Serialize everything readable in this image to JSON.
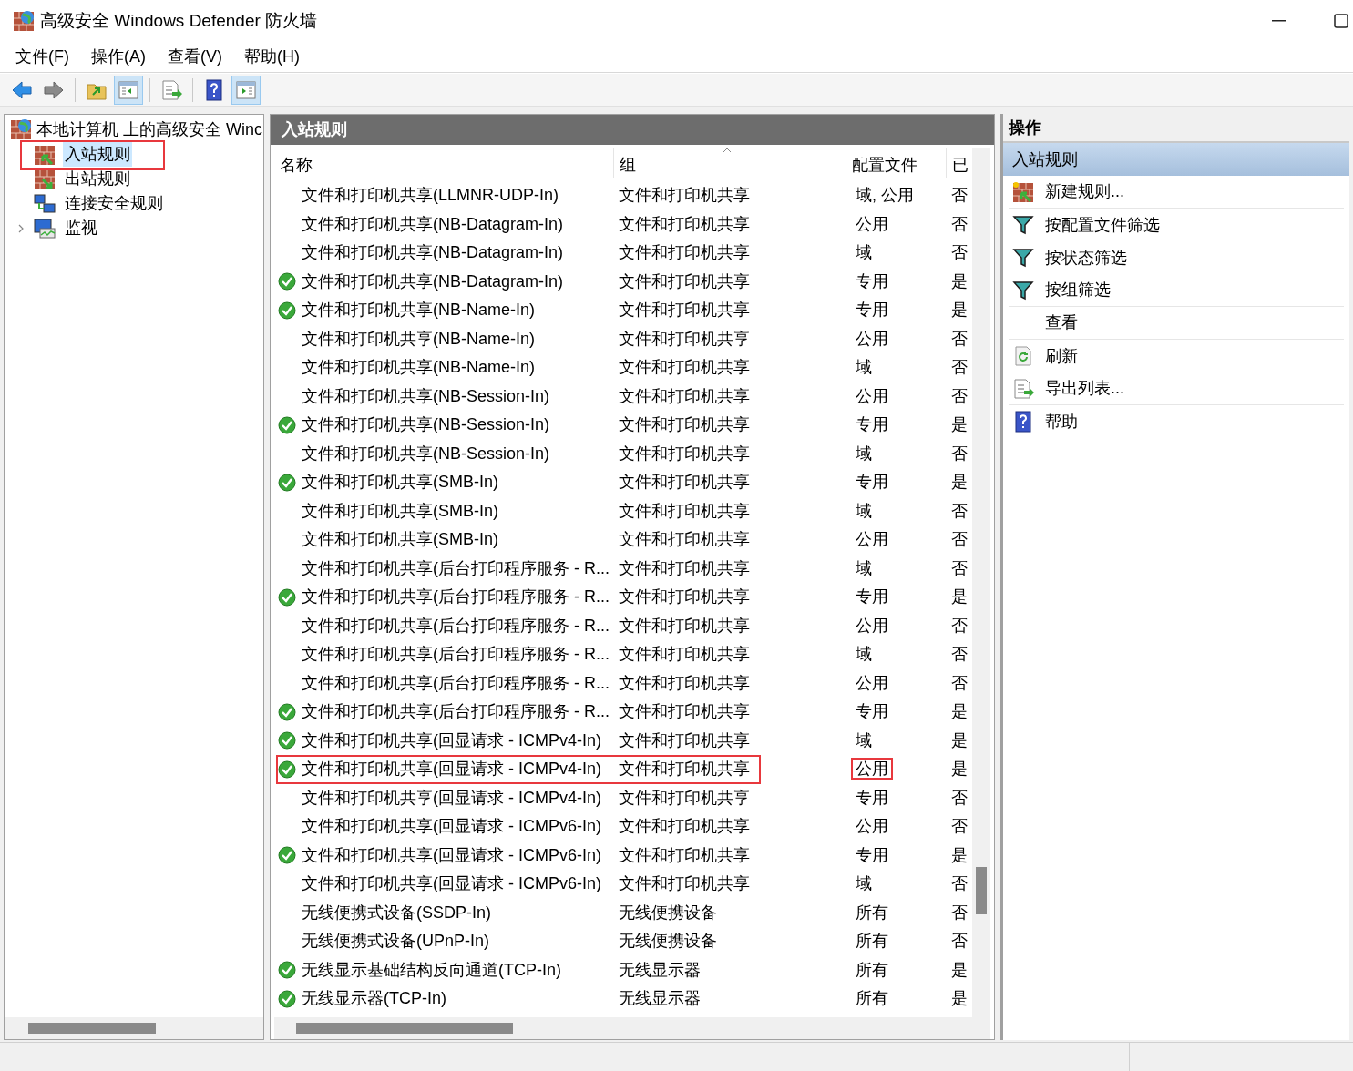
{
  "window": {
    "title": "高级安全 Windows Defender 防火墙"
  },
  "menu": [
    "文件(F)",
    "操作(A)",
    "查看(V)",
    "帮助(H)"
  ],
  "toolbar": [
    {
      "kind": "back",
      "pressed": false
    },
    {
      "kind": "forward",
      "pressed": false
    },
    {
      "kind": "sep"
    },
    {
      "kind": "up",
      "pressed": false
    },
    {
      "kind": "tree",
      "pressed": true
    },
    {
      "kind": "sep"
    },
    {
      "kind": "export",
      "pressed": false
    },
    {
      "kind": "sep"
    },
    {
      "kind": "help",
      "pressed": false
    },
    {
      "kind": "actionpane",
      "pressed": true
    }
  ],
  "tree": {
    "root": "本地计算机 上的高级安全 Winc",
    "items": [
      {
        "label": "入站规则",
        "kind": "inbound",
        "selected": true,
        "marked": true,
        "expandable": false
      },
      {
        "label": "出站规则",
        "kind": "outbound",
        "selected": false,
        "marked": false,
        "expandable": false
      },
      {
        "label": "连接安全规则",
        "kind": "connsec",
        "selected": false,
        "marked": false,
        "expandable": false
      },
      {
        "label": "监视",
        "kind": "monitor",
        "selected": false,
        "marked": false,
        "expandable": true
      }
    ]
  },
  "center": {
    "title": "入站规则",
    "columns": [
      "名称",
      "组",
      "配置文件",
      "已"
    ],
    "rows": [
      {
        "name": "文件和打印机共享(LLMNR-UDP-In)",
        "group": "文件和打印机共享",
        "profile": "域, 公用",
        "enabled_text": "否",
        "enabled": false,
        "marked": false
      },
      {
        "name": "文件和打印机共享(NB-Datagram-In)",
        "group": "文件和打印机共享",
        "profile": "公用",
        "enabled_text": "否",
        "enabled": false,
        "marked": false
      },
      {
        "name": "文件和打印机共享(NB-Datagram-In)",
        "group": "文件和打印机共享",
        "profile": "域",
        "enabled_text": "否",
        "enabled": false,
        "marked": false
      },
      {
        "name": "文件和打印机共享(NB-Datagram-In)",
        "group": "文件和打印机共享",
        "profile": "专用",
        "enabled_text": "是",
        "enabled": true,
        "marked": false
      },
      {
        "name": "文件和打印机共享(NB-Name-In)",
        "group": "文件和打印机共享",
        "profile": "专用",
        "enabled_text": "是",
        "enabled": true,
        "marked": false
      },
      {
        "name": "文件和打印机共享(NB-Name-In)",
        "group": "文件和打印机共享",
        "profile": "公用",
        "enabled_text": "否",
        "enabled": false,
        "marked": false
      },
      {
        "name": "文件和打印机共享(NB-Name-In)",
        "group": "文件和打印机共享",
        "profile": "域",
        "enabled_text": "否",
        "enabled": false,
        "marked": false
      },
      {
        "name": "文件和打印机共享(NB-Session-In)",
        "group": "文件和打印机共享",
        "profile": "公用",
        "enabled_text": "否",
        "enabled": false,
        "marked": false
      },
      {
        "name": "文件和打印机共享(NB-Session-In)",
        "group": "文件和打印机共享",
        "profile": "专用",
        "enabled_text": "是",
        "enabled": true,
        "marked": false
      },
      {
        "name": "文件和打印机共享(NB-Session-In)",
        "group": "文件和打印机共享",
        "profile": "域",
        "enabled_text": "否",
        "enabled": false,
        "marked": false
      },
      {
        "name": "文件和打印机共享(SMB-In)",
        "group": "文件和打印机共享",
        "profile": "专用",
        "enabled_text": "是",
        "enabled": true,
        "marked": false
      },
      {
        "name": "文件和打印机共享(SMB-In)",
        "group": "文件和打印机共享",
        "profile": "域",
        "enabled_text": "否",
        "enabled": false,
        "marked": false
      },
      {
        "name": "文件和打印机共享(SMB-In)",
        "group": "文件和打印机共享",
        "profile": "公用",
        "enabled_text": "否",
        "enabled": false,
        "marked": false
      },
      {
        "name": "文件和打印机共享(后台打印程序服务 - R...",
        "group": "文件和打印机共享",
        "profile": "域",
        "enabled_text": "否",
        "enabled": false,
        "marked": false
      },
      {
        "name": "文件和打印机共享(后台打印程序服务 - R...",
        "group": "文件和打印机共享",
        "profile": "专用",
        "enabled_text": "是",
        "enabled": true,
        "marked": false
      },
      {
        "name": "文件和打印机共享(后台打印程序服务 - R...",
        "group": "文件和打印机共享",
        "profile": "公用",
        "enabled_text": "否",
        "enabled": false,
        "marked": false
      },
      {
        "name": "文件和打印机共享(后台打印程序服务 - R...",
        "group": "文件和打印机共享",
        "profile": "域",
        "enabled_text": "否",
        "enabled": false,
        "marked": false
      },
      {
        "name": "文件和打印机共享(后台打印程序服务 - R...",
        "group": "文件和打印机共享",
        "profile": "公用",
        "enabled_text": "否",
        "enabled": false,
        "marked": false
      },
      {
        "name": "文件和打印机共享(后台打印程序服务 - R...",
        "group": "文件和打印机共享",
        "profile": "专用",
        "enabled_text": "是",
        "enabled": true,
        "marked": false
      },
      {
        "name": "文件和打印机共享(回显请求 - ICMPv4-In)",
        "group": "文件和打印机共享",
        "profile": "域",
        "enabled_text": "是",
        "enabled": true,
        "marked": false
      },
      {
        "name": "文件和打印机共享(回显请求 - ICMPv4-In)",
        "group": "文件和打印机共享",
        "profile": "公用",
        "enabled_text": "是",
        "enabled": true,
        "marked": true
      },
      {
        "name": "文件和打印机共享(回显请求 - ICMPv4-In)",
        "group": "文件和打印机共享",
        "profile": "专用",
        "enabled_text": "否",
        "enabled": false,
        "marked": false
      },
      {
        "name": "文件和打印机共享(回显请求 - ICMPv6-In)",
        "group": "文件和打印机共享",
        "profile": "公用",
        "enabled_text": "否",
        "enabled": false,
        "marked": false
      },
      {
        "name": "文件和打印机共享(回显请求 - ICMPv6-In)",
        "group": "文件和打印机共享",
        "profile": "专用",
        "enabled_text": "是",
        "enabled": true,
        "marked": false
      },
      {
        "name": "文件和打印机共享(回显请求 - ICMPv6-In)",
        "group": "文件和打印机共享",
        "profile": "域",
        "enabled_text": "否",
        "enabled": false,
        "marked": false
      },
      {
        "name": "无线便携式设备(SSDP-In)",
        "group": "无线便携设备",
        "profile": "所有",
        "enabled_text": "否",
        "enabled": false,
        "marked": false
      },
      {
        "name": "无线便携式设备(UPnP-In)",
        "group": "无线便携设备",
        "profile": "所有",
        "enabled_text": "否",
        "enabled": false,
        "marked": false
      },
      {
        "name": "无线显示基础结构反向通道(TCP-In)",
        "group": "无线显示器",
        "profile": "所有",
        "enabled_text": "是",
        "enabled": true,
        "marked": false
      },
      {
        "name": "无线显示器(TCP-In)",
        "group": "无线显示器",
        "profile": "所有",
        "enabled_text": "是",
        "enabled": true,
        "marked": false
      }
    ]
  },
  "actions": {
    "title": "操作",
    "section": "入站规则",
    "items": [
      {
        "label": "新建规则...",
        "kind": "newrule",
        "divider_after": true
      },
      {
        "label": "按配置文件筛选",
        "kind": "filter",
        "divider_after": false
      },
      {
        "label": "按状态筛选",
        "kind": "filter",
        "divider_after": false
      },
      {
        "label": "按组筛选",
        "kind": "filter",
        "divider_after": true
      },
      {
        "label": "查看",
        "kind": "none",
        "divider_after": true
      },
      {
        "label": "刷新",
        "kind": "refresh",
        "divider_after": false
      },
      {
        "label": "导出列表...",
        "kind": "export",
        "divider_after": true
      },
      {
        "label": "帮助",
        "kind": "help",
        "divider_after": false
      }
    ]
  }
}
